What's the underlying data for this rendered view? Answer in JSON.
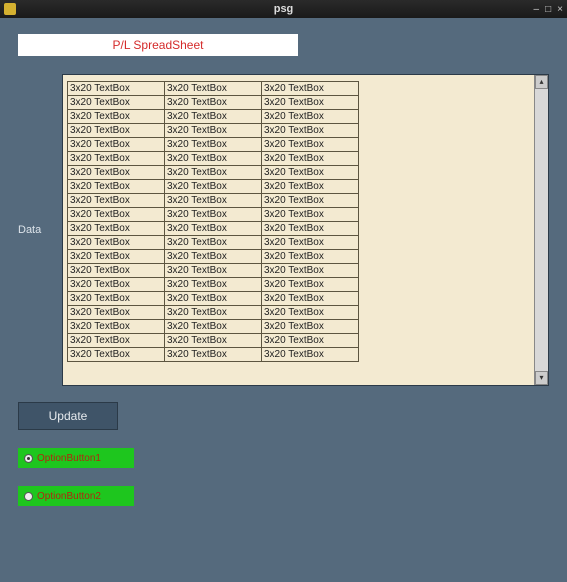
{
  "window": {
    "title": "psg"
  },
  "header": {
    "value": "P/L SpreadSheet"
  },
  "data_label": "Data",
  "grid": {
    "rows": 20,
    "cols": 3,
    "cell_value": "3x20 TextBox"
  },
  "update_button": "Update",
  "radios": [
    {
      "label": "OptionButton1",
      "selected": true
    },
    {
      "label": "OptionButton2",
      "selected": false
    }
  ]
}
